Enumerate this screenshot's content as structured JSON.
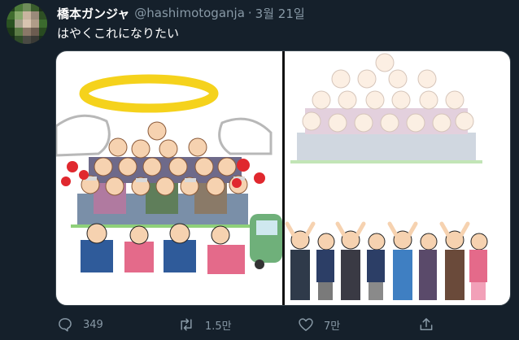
{
  "tweet": {
    "display_name": "橋本ガンジャ",
    "handle": "@hashimotoganja",
    "separator": "·",
    "date": "3월 21일",
    "text": "はやくこれになりたい"
  },
  "actions": {
    "reply_count": "349",
    "retweet_count": "1.5만",
    "like_count": "7만",
    "share_count": ""
  },
  "icons": {
    "reply": "reply-icon",
    "retweet": "retweet-icon",
    "like": "heart-icon",
    "share": "share-icon"
  },
  "colors": {
    "background": "#15202b",
    "secondary_text": "#8899a6",
    "border": "#38444d",
    "halo": "#f5d21c",
    "virus": "#e0282e"
  }
}
